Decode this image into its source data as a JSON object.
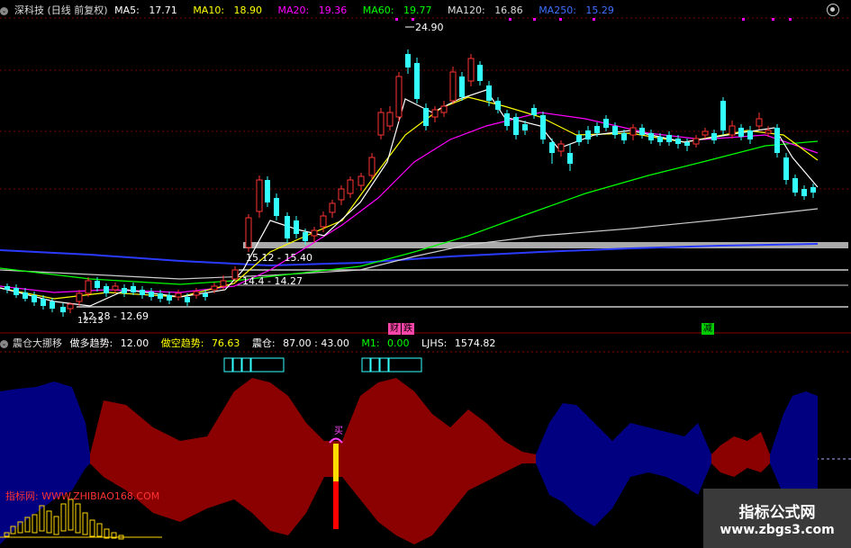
{
  "main_chart": {
    "title": "深科技 (日线 前复权)",
    "ma_lines": [
      {
        "label": "MA5:",
        "value": "17.71",
        "color": "#ffffff"
      },
      {
        "label": "MA10:",
        "value": "18.90",
        "color": "#ffff00"
      },
      {
        "label": "MA20:",
        "value": "19.36",
        "color": "#ff00ff"
      },
      {
        "label": "MA60:",
        "value": "19.77",
        "color": "#00ff00"
      },
      {
        "label": "MA120:",
        "value": "16.86",
        "color": "#dddddd"
      },
      {
        "label": "MA250:",
        "value": "15.29",
        "color": "#3f6fff"
      }
    ],
    "annotations": {
      "high": "24.90",
      "range1": "15.12 - 15.40",
      "range2": "14.4 - 14.27",
      "range3": "12.28 - 12.69",
      "low_mark": "12.13"
    },
    "event_tags": {
      "tag1": "财",
      "tag2": "跌",
      "tag3": "减"
    },
    "colors": {
      "up": "#ff3333",
      "down": "#33ffff",
      "bg": "#000000",
      "grid": "#880000"
    }
  },
  "indicator": {
    "title": "震仓大挪移",
    "items": [
      {
        "label": "做多趋势:",
        "value": "12.00",
        "color": "#ffffff"
      },
      {
        "label": "做空趋势:",
        "value": "76.63",
        "color": "#ffff00"
      },
      {
        "label": "震仓:",
        "value": "87.00 : 43.00",
        "color": "#ffffff"
      },
      {
        "label": "M1:",
        "value": "0.00",
        "color": "#00ff00"
      },
      {
        "label": "LJHS:",
        "value": "1574.82",
        "color": "#ffffff"
      }
    ],
    "buy_signal": "买",
    "watermark": "指标网: WWW.ZHIBIAO168.COM",
    "colors": {
      "bull": "#8b0000",
      "bear": "#000080"
    }
  },
  "brand": {
    "title": "指标公式网",
    "url": "www.zbgs3.com"
  }
}
